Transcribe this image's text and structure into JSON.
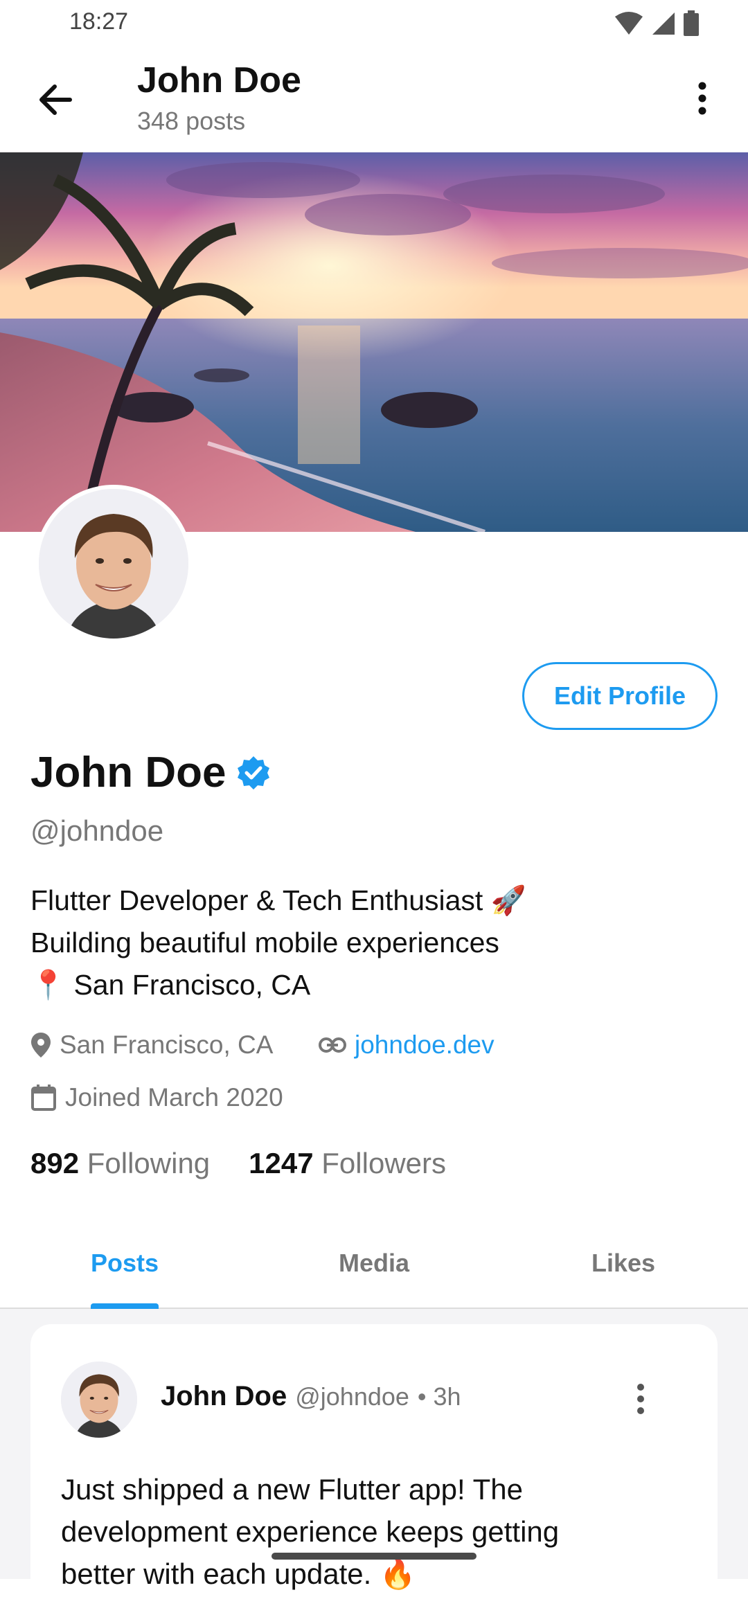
{
  "status": {
    "time": "18:27"
  },
  "appbar": {
    "title": "John Doe",
    "subtitle": "348 posts"
  },
  "profile": {
    "name": "John Doe",
    "handle": "@johndoe",
    "edit_label": "Edit Profile",
    "bio_lines": [
      "Flutter Developer & Tech Enthusiast 🚀",
      "Building beautiful mobile experiences",
      "📍 San Francisco, CA"
    ],
    "location": "San Francisco, CA",
    "website": "johndoe.dev",
    "joined": "Joined March 2020",
    "following_count": "892",
    "following_label": "Following",
    "followers_count": "1247",
    "followers_label": "Followers"
  },
  "tabs": [
    {
      "label": "Posts",
      "active": true
    },
    {
      "label": "Media",
      "active": false
    },
    {
      "label": "Likes",
      "active": false
    }
  ],
  "post": {
    "author": "John Doe",
    "handle": "@johndoe",
    "time": "• 3h",
    "text_lines": [
      "Just shipped a new Flutter app! The",
      "development experience keeps getting",
      "better with each update. 🔥"
    ]
  },
  "colors": {
    "accent": "#1d9bf0",
    "muted": "#777777"
  }
}
